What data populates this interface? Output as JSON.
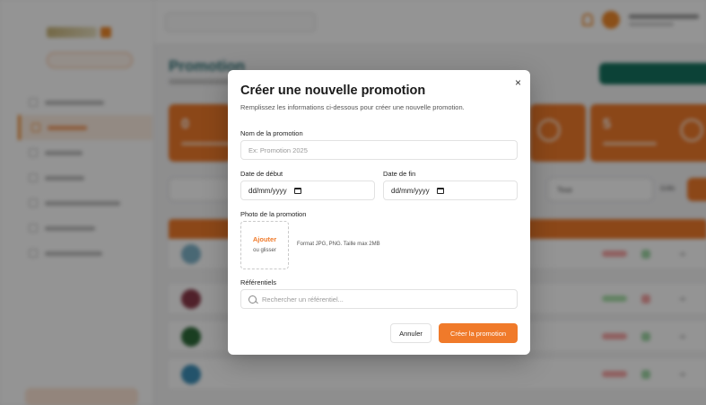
{
  "background": {
    "page_title": "Promotion",
    "stats": [
      {
        "value": "0"
      },
      {
        "value": "5"
      }
    ],
    "filter_select": "Tous",
    "filter_grid": "Grille",
    "rows": [
      {
        "thumb_color": "#7fb3c9",
        "badge_color": "#f7a3a3",
        "status_color": "#9fd6a5"
      },
      {
        "thumb_color": "#8b3a4a",
        "badge_color": "#a9e0a9",
        "status_color": "#f5a3a3"
      },
      {
        "thumb_color": "#2e6b3a",
        "badge_color": "#f7a3a3",
        "status_color": "#9fd6a5"
      },
      {
        "thumb_color": "#3d8fb8",
        "badge_color": "#f7a3a3",
        "status_color": "#9fd6a5"
      }
    ]
  },
  "modal": {
    "title": "Créer une nouvelle promotion",
    "description": "Remplissez les informations ci-dessous pour créer une nouvelle promotion.",
    "close_icon": "close-icon",
    "name_label": "Nom de la promotion",
    "name_placeholder": "Ex: Promotion 2025",
    "start_label": "Date de début",
    "start_value": "dd/mm/yyyy",
    "end_label": "Date de fin",
    "end_value": "dd/mm/yyyy",
    "photo_label": "Photo de la promotion",
    "photo_add": "Ajouter",
    "photo_drag": "ou glisser",
    "photo_hint": "Format JPG, PNG. Taille max 2MB",
    "referentials_label": "Référentiels",
    "referentials_placeholder": "Rechercher un référentiel...",
    "cancel_label": "Annuler",
    "create_label": "Créer la promotion"
  },
  "colors": {
    "accent": "#f07a2a",
    "brand_teal": "#2b6f73"
  }
}
